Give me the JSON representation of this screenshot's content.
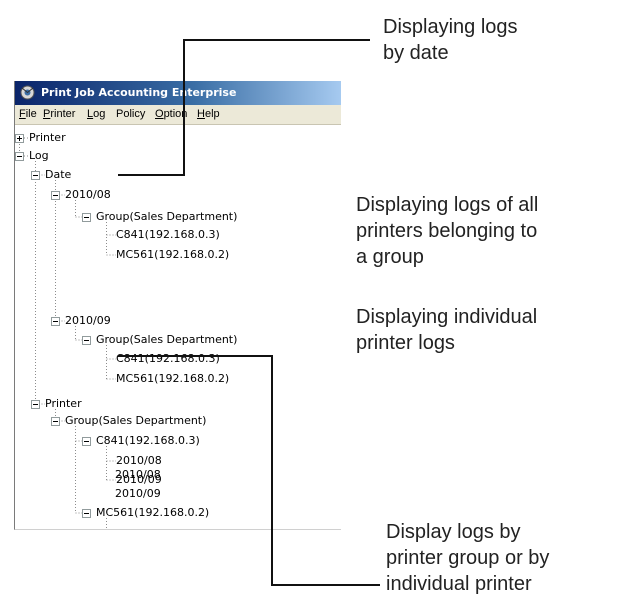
{
  "window": {
    "title": "Print Job Accounting Enterprise",
    "menu": [
      {
        "mnemonic": "F",
        "rest": "ile"
      },
      {
        "mnemonic": "P",
        "rest": "rinter"
      },
      {
        "mnemonic": "L",
        "rest": "og"
      },
      {
        "mnemonic": "",
        "rest": "Policy"
      },
      {
        "mnemonic": "O",
        "rest": "ption"
      },
      {
        "mnemonic": "H",
        "rest": "elp"
      }
    ]
  },
  "tree": {
    "printer_root": "Printer",
    "log_root": "Log",
    "date_node": "Date",
    "date_month_1": "2010/08",
    "date_group_1": "Group(Sales Department)",
    "date_p1_1": "C841(192.168.0.3)",
    "date_p2_1": "MC561(192.168.0.2)",
    "date_month_2": "2010/09",
    "date_group_2": "Group(Sales Department)",
    "date_p1_2": "C841(192.168.0.3)",
    "date_p2_2": "MC561(192.168.0.2)",
    "printer_node": "Printer",
    "printer_group": "Group(Sales Department)",
    "printer_c841": "C841(192.168.0.3)",
    "c841_month_1": "2010/08",
    "c841_month_2": "2010/09",
    "printer_mc561": "MC561(192.168.0.2)",
    "mc561_month_1": "2010/08",
    "mc561_month_2": "2010/09"
  },
  "annotations": {
    "by_date": [
      "Displaying logs",
      "by date"
    ],
    "group": [
      "Displaying logs of all",
      "printers belonging to",
      "a group"
    ],
    "individual": [
      "Displaying individual",
      "printer logs"
    ],
    "by_printer": [
      "Display logs by",
      "printer group or by",
      "individual printer"
    ]
  }
}
